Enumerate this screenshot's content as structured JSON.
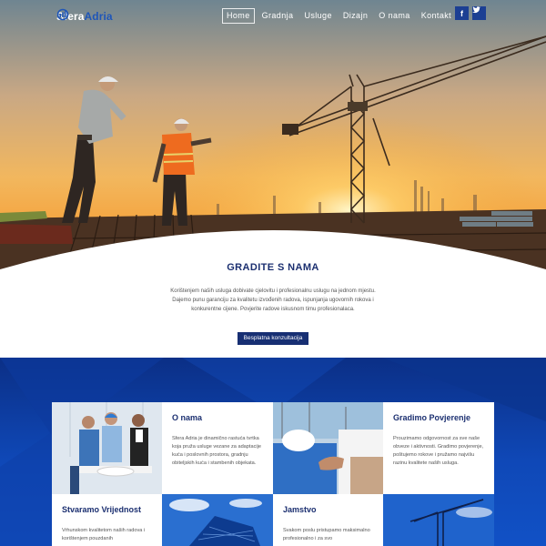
{
  "header": {
    "logo": {
      "part1": "Sfera",
      "part2": "Adria"
    },
    "nav": [
      {
        "label": "Home",
        "active": true
      },
      {
        "label": "Gradnja",
        "active": false
      },
      {
        "label": "Usluge",
        "active": false
      },
      {
        "label": "Dizajn",
        "active": false
      },
      {
        "label": "O nama",
        "active": false
      },
      {
        "label": "Kontakt",
        "active": false
      }
    ],
    "social": {
      "facebook": "f",
      "twitter": "t"
    }
  },
  "intro": {
    "title": "GRADITE S NAMA",
    "text": "Korištenjem naših usluga dobivate cjelovitu i profesionalnu uslugu na jednom mjestu. Dajemo punu garanciju za kvalitetu izvođenih radova, ispunjanja ugovornih rokova i konkurentne cijene. Povjerite radove iskusnom timu profesionalaca.",
    "button": "Besplatna konzultacija"
  },
  "cards": {
    "o_nama": {
      "title": "O nama",
      "text": "Sfera Adria je dinamično rastuća tvrtka koja pruža usluge vezane za adaptacije kuća i poslovnih prostora, gradnju obiteljskih kuća i stambenih objekata."
    },
    "povjerenje": {
      "title": "Gradimo Povjerenje",
      "text": "Prouzimamo odgovornost za sve naše obveze i aktivnosti. Gradimo povjerenje, poštujemo rokove i pružamo najvišu razinu kvalitete naših usluga."
    },
    "vrijednost": {
      "title": "Stvaramo Vrijednost",
      "text": "Vrhunskom kvalitetom naših radova i korištenjem pouzdanih"
    },
    "jamstvo": {
      "title": "Jamstvo",
      "text": "Svakom poslu pristupamo maksimalno profesionalno i za svo"
    }
  },
  "colors": {
    "brand": "#1f56b8",
    "navy": "#172f73",
    "blue": "#0f48b7",
    "sunset": "#f2a53a"
  },
  "icons": {
    "facebook": "facebook-icon",
    "twitter": "twitter-icon",
    "logo": "sphere-logo-icon"
  }
}
